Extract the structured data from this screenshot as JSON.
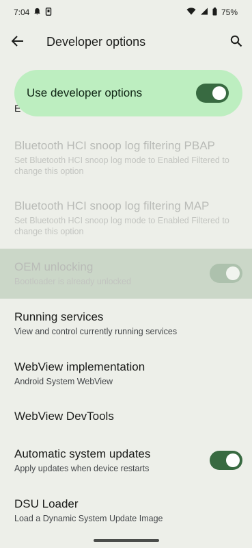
{
  "status_bar": {
    "time": "7:04",
    "battery": "75%"
  },
  "app_bar": {
    "title": "Developer options"
  },
  "master_switch": {
    "label": "Use developer options",
    "on": true
  },
  "partial_item_letter": "E",
  "items": [
    {
      "title": "Bluetooth HCI snoop log filtering PBAP",
      "summary": "Set Bluetooth HCI snoop log mode to Enabled Filtered to change this option"
    },
    {
      "title": "Bluetooth HCI snoop log filtering MAP",
      "summary": "Set Bluetooth HCI snoop log mode to Enabled Filtered to change this option"
    },
    {
      "title": "OEM unlocking",
      "summary": "Bootloader is already unlocked"
    },
    {
      "title": "Running services",
      "summary": "View and control currently running services"
    },
    {
      "title": "WebView implementation",
      "summary": "Android System WebView"
    },
    {
      "title": "WebView DevTools"
    },
    {
      "title": "Automatic system updates",
      "summary": "Apply updates when device restarts"
    },
    {
      "title": "DSU Loader",
      "summary": "Load a Dynamic System Update Image"
    }
  ],
  "colors": {
    "background": "#edefe9",
    "master_switch_bg": "#bdeec0",
    "toggle_on": "#386a41",
    "highlight_row": "#cbd7c8"
  },
  "icons": {
    "back": "arrow-left-icon",
    "search": "search-icon",
    "wifi": "wifi-icon",
    "signal": "signal-icon",
    "battery": "battery-icon",
    "notification": "notification-icon"
  }
}
